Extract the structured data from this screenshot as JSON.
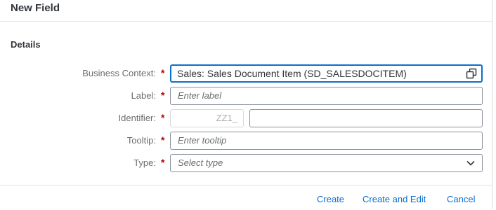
{
  "dialog": {
    "title": "New Field",
    "section_title": "Details"
  },
  "form": {
    "business_context": {
      "label": "Business Context:",
      "required": "*",
      "value": "Sales: Sales Document Item (SD_SALESDOCITEM)",
      "icon": "value-help-icon"
    },
    "label_field": {
      "label": "Label:",
      "required": "*",
      "placeholder": "Enter label"
    },
    "identifier": {
      "label": "Identifier:",
      "required": "*",
      "prefix": "ZZ1_",
      "value": ""
    },
    "tooltip": {
      "label": "Tooltip:",
      "required": "*",
      "placeholder": "Enter tooltip"
    },
    "type": {
      "label": "Type:",
      "required": "*",
      "placeholder": "Select type",
      "icon": "chevron-down-icon"
    }
  },
  "footer": {
    "create_label": "Create",
    "create_edit_label": "Create and Edit",
    "cancel_label": "Cancel"
  },
  "colors": {
    "accent": "#0a6ed1",
    "required": "#bb0000",
    "label": "#6a6d70"
  }
}
